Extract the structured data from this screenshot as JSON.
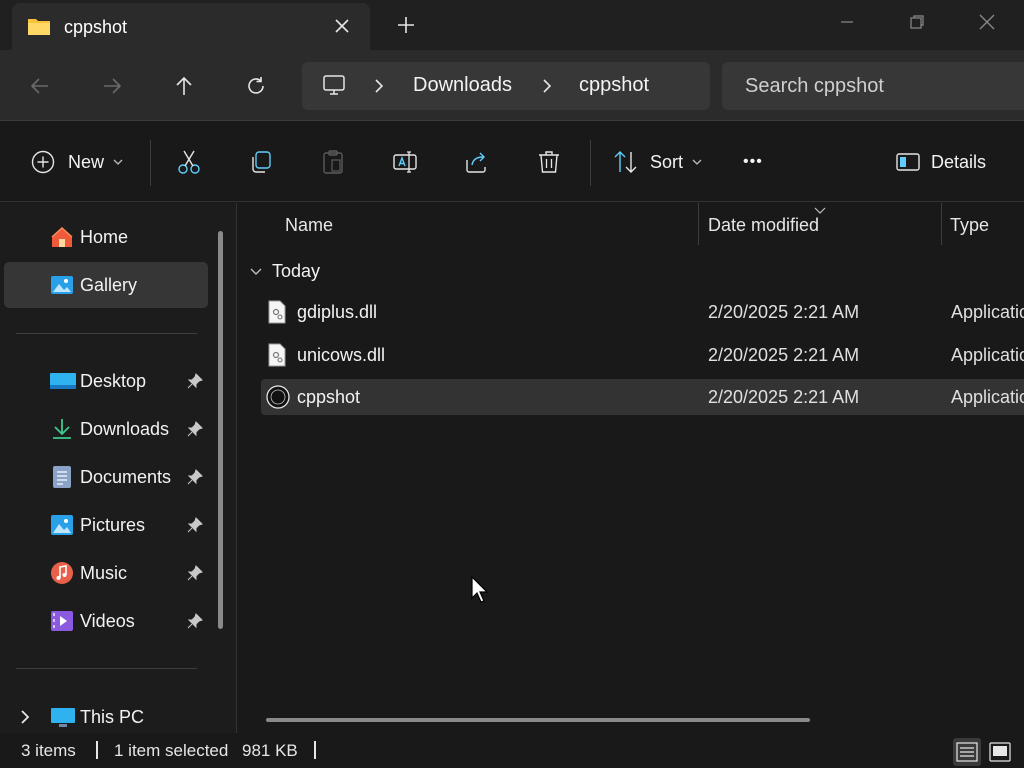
{
  "window": {
    "tab_title": "cppshot",
    "new_tab_label": "+"
  },
  "nav": {
    "breadcrumbs": [
      "Downloads",
      "cppshot"
    ],
    "search_placeholder": "Search cppshot"
  },
  "commands": {
    "new_label": "New",
    "sort_label": "Sort",
    "more_label": "•••",
    "details_label": "Details"
  },
  "sidebar": {
    "items": [
      {
        "label": "Home"
      },
      {
        "label": "Gallery"
      },
      {
        "label": "Desktop"
      },
      {
        "label": "Downloads"
      },
      {
        "label": "Documents"
      },
      {
        "label": "Pictures"
      },
      {
        "label": "Music"
      },
      {
        "label": "Videos"
      },
      {
        "label": "This PC"
      }
    ]
  },
  "list": {
    "columns": [
      "Name",
      "Date modified",
      "Type"
    ],
    "group_label": "Today",
    "rows": [
      {
        "name": "gdiplus.dll",
        "date": "2/20/2025 2:21 AM",
        "type": "Application extension"
      },
      {
        "name": "unicows.dll",
        "date": "2/20/2025 2:21 AM",
        "type": "Application extension"
      },
      {
        "name": "cppshot",
        "date": "2/20/2025 2:21 AM",
        "type": "Application"
      }
    ]
  },
  "status": {
    "item_count": "3 items",
    "selected": "1 item selected",
    "size": "981 KB"
  },
  "colors": {
    "folder": "#f8c23a",
    "accent": "#60cdff",
    "selection": "#333333"
  }
}
